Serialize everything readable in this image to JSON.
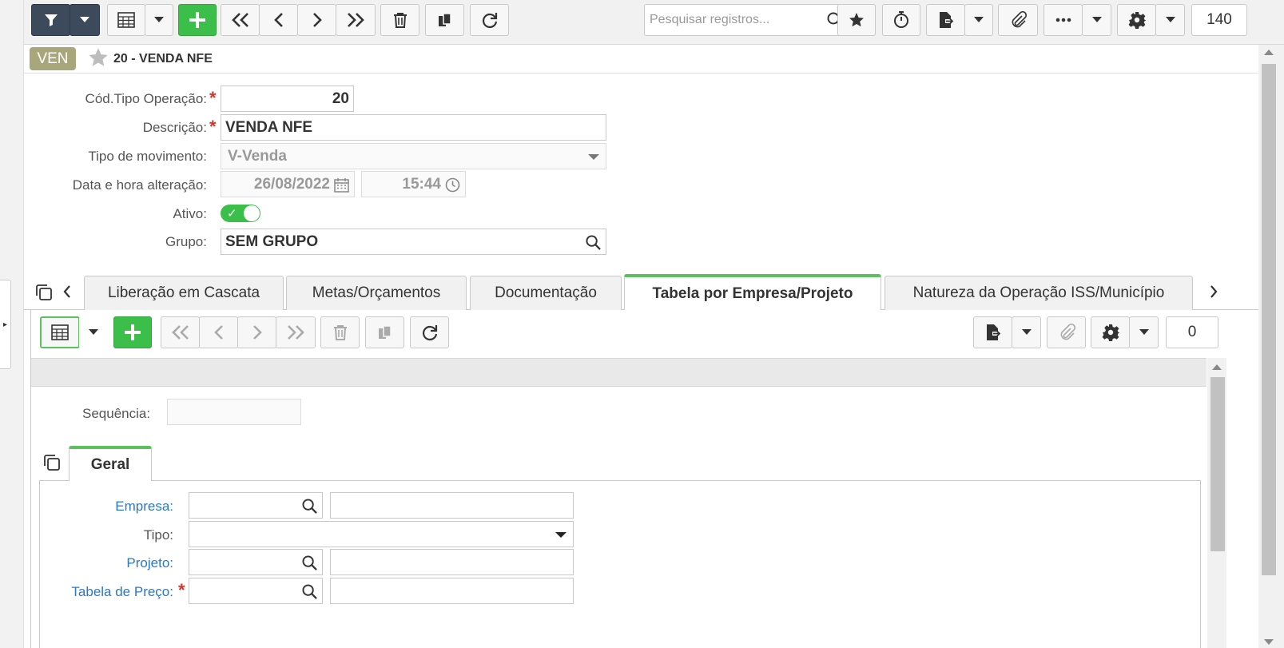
{
  "toolbar": {
    "search_placeholder": "Pesquisar registros...",
    "record_count": "140"
  },
  "record": {
    "badge": "VEN",
    "title": "20 - VENDA NFE"
  },
  "form": {
    "cod_label": "Cód.Tipo Operação:",
    "cod_value": "20",
    "desc_label": "Descrição:",
    "desc_value": "VENDA NFE",
    "tipo_mov_label": "Tipo de movimento:",
    "tipo_mov_value": "V-Venda",
    "data_label": "Data e hora alteração:",
    "data_value": "26/08/2022",
    "hora_value": "15:44",
    "ativo_label": "Ativo:",
    "grupo_label": "Grupo:",
    "grupo_value": "SEM GRUPO",
    "required_mark": "*"
  },
  "tabs": [
    {
      "label": "Liberação em Cascata"
    },
    {
      "label": "Metas/Orçamentos"
    },
    {
      "label": "Documentação"
    },
    {
      "label": "Tabela por Empresa/Projeto",
      "active": true
    },
    {
      "label": "Natureza da Operação ISS/Município"
    }
  ],
  "detail": {
    "record_count": "0",
    "sequencia_label": "Sequência:",
    "geral_tab": "Geral",
    "empresa_label": "Empresa:",
    "tipo_label": "Tipo:",
    "projeto_label": "Projeto:",
    "tabela_label": "Tabela de Preço:"
  },
  "colors": {
    "accent_green": "#3cbf4a",
    "dark_button": "#3d4a5c",
    "badge": "#a8a77c",
    "link_label": "#2b78c5",
    "required": "#d9342b"
  }
}
